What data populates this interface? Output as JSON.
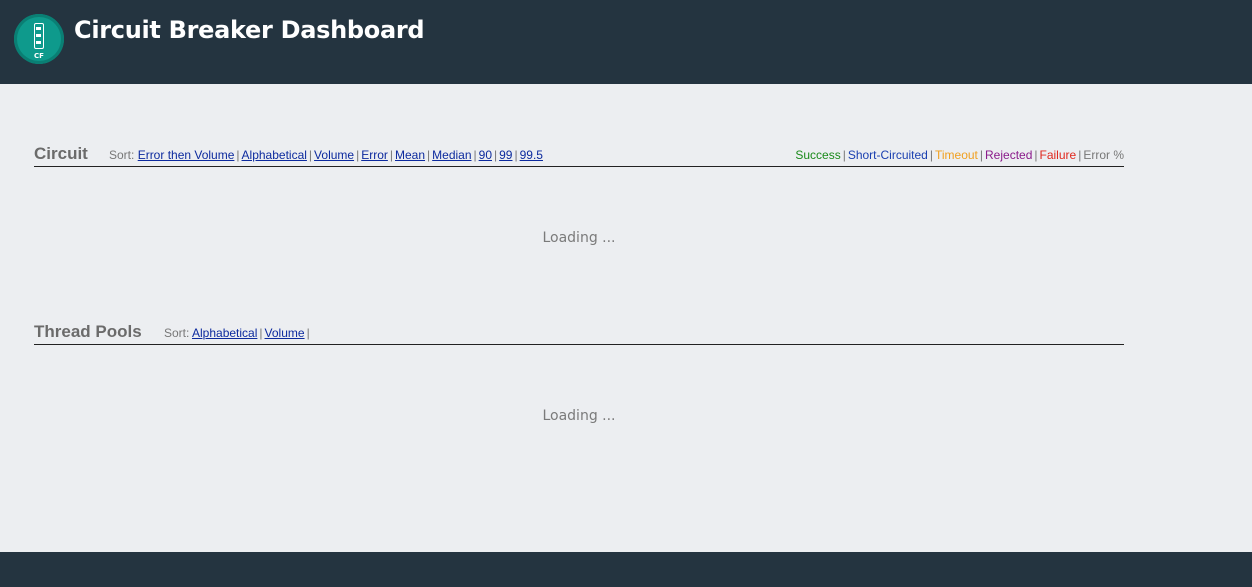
{
  "header": {
    "logo_text": "CF",
    "title": "Circuit Breaker Dashboard"
  },
  "circuit": {
    "title": "Circuit",
    "sort_label": "Sort:",
    "sort_options": [
      "Error then Volume",
      "Alphabetical",
      "Volume",
      "Error",
      "Mean",
      "Median",
      "90",
      "99",
      "99.5"
    ],
    "legend": [
      {
        "label": "Success",
        "color": "#1a8a1a"
      },
      {
        "label": "Short-Circuited",
        "color": "#1a3fb0"
      },
      {
        "label": "Timeout",
        "color": "#f0a020"
      },
      {
        "label": "Rejected",
        "color": "#8a1a8a"
      },
      {
        "label": "Failure",
        "color": "#e0281e"
      },
      {
        "label": "Error %",
        "color": "#777777"
      }
    ],
    "loading": "Loading ..."
  },
  "thread_pools": {
    "title": "Thread Pools",
    "sort_label": "Sort:",
    "sort_options": [
      "Alphabetical",
      "Volume"
    ],
    "loading": "Loading ..."
  },
  "colors": {
    "header_bg": "#243440",
    "page_bg": "#eceef1",
    "link": "#0c2a9e",
    "separator": "|"
  }
}
